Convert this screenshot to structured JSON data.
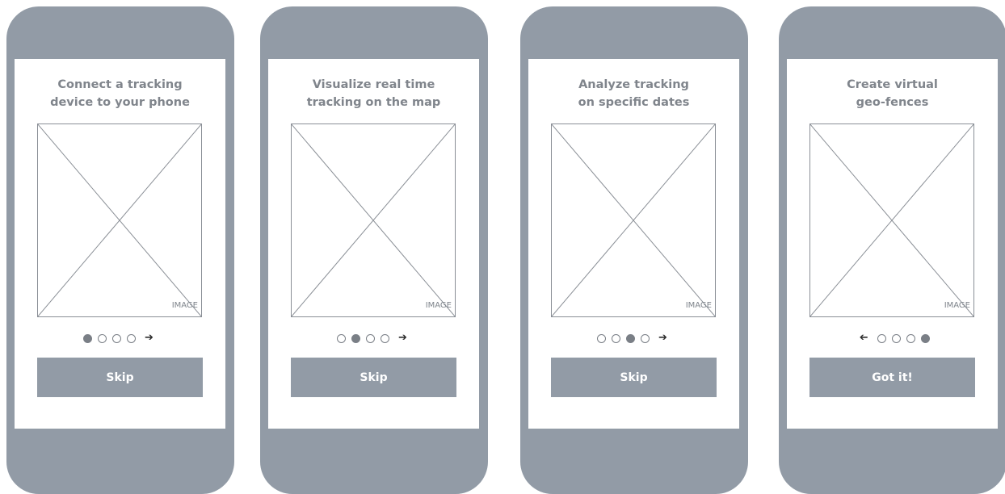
{
  "screens": [
    {
      "title": "Connect a tracking\ndevice to your phone",
      "image_label": "IMAGE",
      "active_dot": 0,
      "nav_arrow": "next",
      "button_label": "Skip"
    },
    {
      "title": "Visualize real time\ntracking on the map",
      "image_label": "IMAGE",
      "active_dot": 1,
      "nav_arrow": "next",
      "button_label": "Skip"
    },
    {
      "title": "Analyze tracking\non specific dates",
      "image_label": "IMAGE",
      "active_dot": 2,
      "nav_arrow": "next",
      "button_label": "Skip"
    },
    {
      "title": "Create virtual\ngeo-fences",
      "image_label": "IMAGE",
      "active_dot": 3,
      "nav_arrow": "prev",
      "button_label": "Got it!"
    }
  ],
  "pager_dot_count": 4,
  "colors": {
    "phone_frame": "#929ba6",
    "screen_bg": "#ffffff",
    "title_text": "#80858c",
    "dot": "#7a7f86",
    "button_bg": "#929ba6",
    "button_text": "#ffffff"
  },
  "icons": {
    "next": "arrow-right-icon",
    "prev": "arrow-left-icon"
  }
}
